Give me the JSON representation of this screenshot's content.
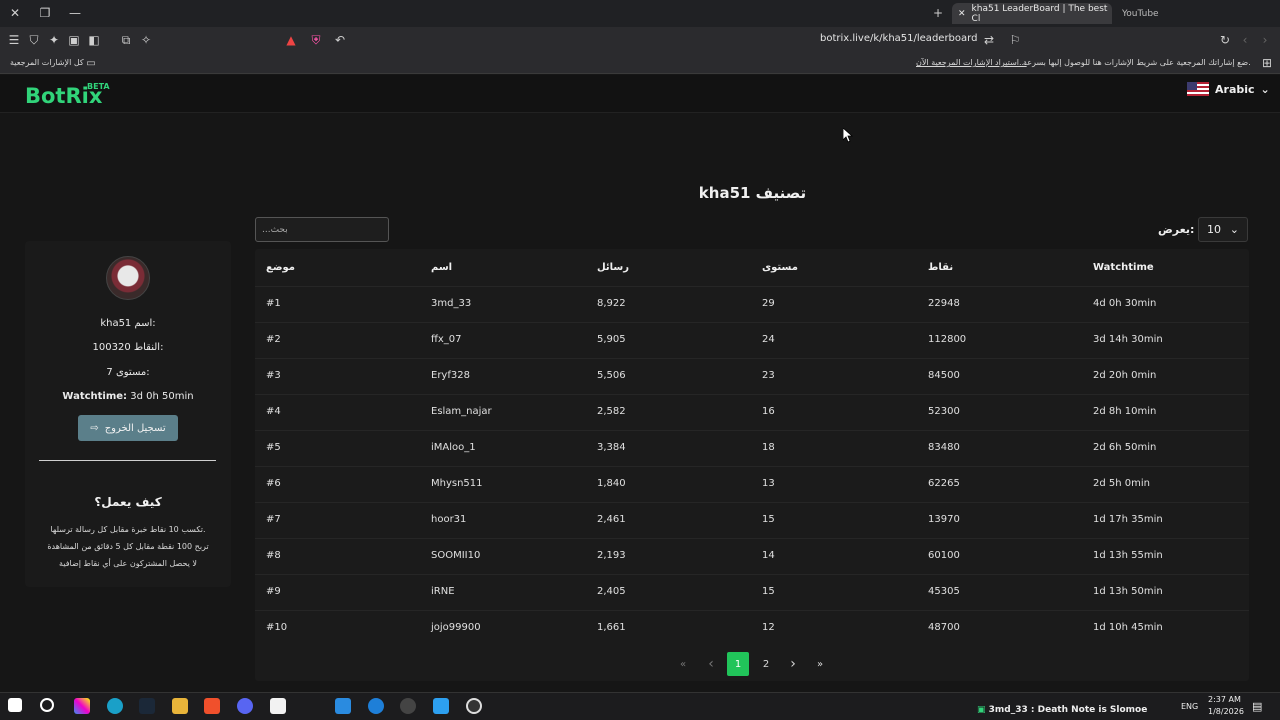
{
  "browser": {
    "active_tab_title": "kha51 LeaderBoard | The best Cl",
    "inactive_tab_title": "YouTube",
    "url": "botrix.live/k/kha51/leaderboard",
    "bookmarks_hint": "ضع إشاراتك المرجعية على شريط الإشارات هنا للوصول إليها بسرعة.",
    "bookmarks_import": "استيراد الإشارات المرجعية الآن...",
    "all_bookmarks": "كل الإشارات المرجعية"
  },
  "header": {
    "logo": "BotRix",
    "beta": "BETA",
    "language": "Arabic"
  },
  "page": {
    "title": "kha51 تصنيف",
    "search_placeholder": "...بحث",
    "show_label": "يعرض:",
    "show_value": "10"
  },
  "sidebar": {
    "name": "kha51 اسم:",
    "points": "100320 النقاط:",
    "level": "7 مستوى:",
    "watchtime_label": "Watchtime:",
    "watchtime_value": "3d 0h 50min",
    "logout": "تسجيل الخروج",
    "how_title": "كيف يعمل؟",
    "how_lines": [
      "تكسب 10 نقاط خبرة مقابل كل رسالة ترسلها.",
      "تربح 100 نقطة مقابل كل 5 دقائق من المشاهدة",
      "لا يحصل المشتركون على أي نقاط إضافية"
    ]
  },
  "table": {
    "headers": [
      "موضع",
      "اسم",
      "رسائل",
      "مستوى",
      "نقاط",
      "Watchtime"
    ],
    "rows": [
      [
        "#1",
        "3md_33",
        "8,922",
        "29",
        "22948",
        "4d 0h 30min"
      ],
      [
        "#2",
        "ffx_07",
        "5,905",
        "24",
        "112800",
        "3d 14h 30min"
      ],
      [
        "#3",
        "Eryf328",
        "5,506",
        "23",
        "84500",
        "2d 20h 0min"
      ],
      [
        "#4",
        "Eslam_najar",
        "2,582",
        "16",
        "52300",
        "2d 8h 10min"
      ],
      [
        "#5",
        "iMAloo_1",
        "3,384",
        "18",
        "83480",
        "2d 6h 50min"
      ],
      [
        "#6",
        "Mhysn511",
        "1,840",
        "13",
        "62265",
        "2d 5h 0min"
      ],
      [
        "#7",
        "hoor31",
        "2,461",
        "15",
        "13970",
        "1d 17h 35min"
      ],
      [
        "#8",
        "SOOMII10",
        "2,193",
        "14",
        "60100",
        "1d 13h 55min"
      ],
      [
        "#9",
        "iRNE",
        "2,405",
        "15",
        "45305",
        "1d 13h 50min"
      ],
      [
        "#10",
        "jojo99900",
        "1,661",
        "12",
        "48700",
        "1d 10h 45min"
      ]
    ]
  },
  "pagination": {
    "first": "«",
    "prev": "‹",
    "pages": [
      "1",
      "2"
    ],
    "next": "›",
    "last": "»"
  },
  "taskbar": {
    "now_playing": "3md_33 : Death Note is Slomoe",
    "lang": "ENG",
    "time": "2:37 AM",
    "date": "1/8/2026"
  },
  "colors": {
    "accent": "#21c45a",
    "logo": "#31d47a",
    "logout": "#5b7f8a"
  }
}
